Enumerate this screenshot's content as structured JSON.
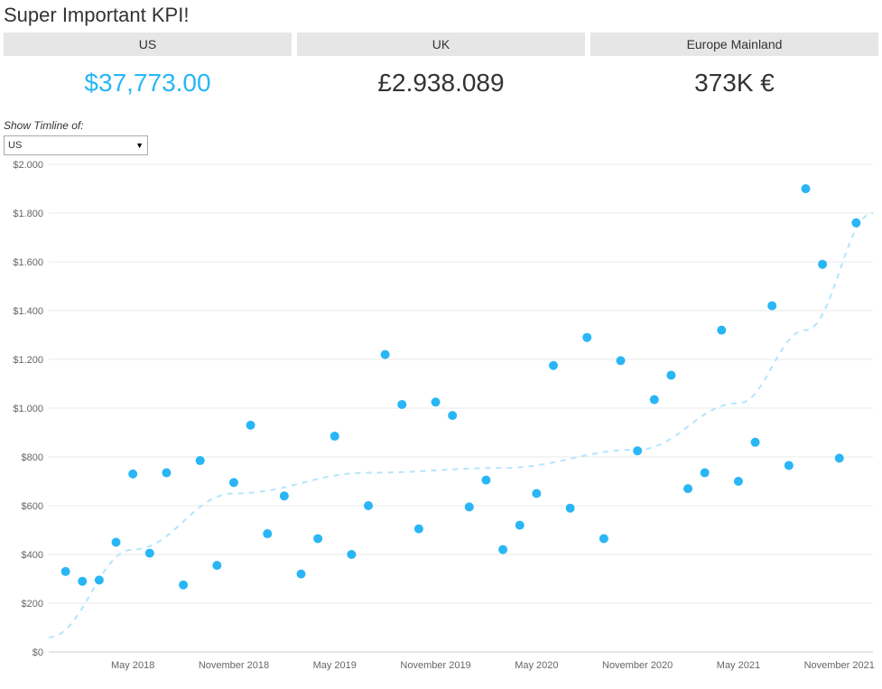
{
  "title": "Super Important KPI!",
  "kpis": [
    {
      "label": "US",
      "value": "$37,773.00",
      "accent": true
    },
    {
      "label": "UK",
      "value": "£2.938.089",
      "accent": false
    },
    {
      "label": "Europe Mainland",
      "value": "373K €",
      "accent": false
    }
  ],
  "filter": {
    "label": "Show Timline of:",
    "selected": "US"
  },
  "chart_data": {
    "type": "scatter",
    "title": "",
    "xlabel": "",
    "ylabel": "",
    "ylim": [
      0,
      2000
    ],
    "y_ticks": [
      "$0",
      "$200",
      "$400",
      "$600",
      "$800",
      "$1.000",
      "$1.200",
      "$1.400",
      "$1.600",
      "$1.800",
      "$2.000"
    ],
    "x_ticks": [
      "May 2018",
      "November 2018",
      "May 2019",
      "November 2019",
      "May 2020",
      "November 2020",
      "May 2021",
      "November 2021"
    ],
    "series": [
      {
        "name": "US",
        "points": [
          {
            "t": 0,
            "y": 330
          },
          {
            "t": 1,
            "y": 290
          },
          {
            "t": 2,
            "y": 295
          },
          {
            "t": 3,
            "y": 450
          },
          {
            "t": 4,
            "y": 730
          },
          {
            "t": 5,
            "y": 405
          },
          {
            "t": 6,
            "y": 735
          },
          {
            "t": 7,
            "y": 275
          },
          {
            "t": 8,
            "y": 785
          },
          {
            "t": 9,
            "y": 355
          },
          {
            "t": 10,
            "y": 695
          },
          {
            "t": 11,
            "y": 930
          },
          {
            "t": 12,
            "y": 485
          },
          {
            "t": 13,
            "y": 640
          },
          {
            "t": 14,
            "y": 320
          },
          {
            "t": 15,
            "y": 465
          },
          {
            "t": 16,
            "y": 885
          },
          {
            "t": 17,
            "y": 400
          },
          {
            "t": 18,
            "y": 600
          },
          {
            "t": 19,
            "y": 1220
          },
          {
            "t": 20,
            "y": 1015
          },
          {
            "t": 21,
            "y": 505
          },
          {
            "t": 22,
            "y": 1025
          },
          {
            "t": 23,
            "y": 970
          },
          {
            "t": 24,
            "y": 595
          },
          {
            "t": 25,
            "y": 705
          },
          {
            "t": 26,
            "y": 420
          },
          {
            "t": 27,
            "y": 520
          },
          {
            "t": 28,
            "y": 650
          },
          {
            "t": 29,
            "y": 1175
          },
          {
            "t": 30,
            "y": 590
          },
          {
            "t": 31,
            "y": 1290
          },
          {
            "t": 32,
            "y": 465
          },
          {
            "t": 33,
            "y": 1195
          },
          {
            "t": 34,
            "y": 825
          },
          {
            "t": 35,
            "y": 1035
          },
          {
            "t": 36,
            "y": 1135
          },
          {
            "t": 37,
            "y": 670
          },
          {
            "t": 38,
            "y": 735
          },
          {
            "t": 39,
            "y": 1320
          },
          {
            "t": 40,
            "y": 700
          },
          {
            "t": 41,
            "y": 860
          },
          {
            "t": 42,
            "y": 1420
          },
          {
            "t": 43,
            "y": 765
          },
          {
            "t": 44,
            "y": 1900
          },
          {
            "t": 45,
            "y": 1590
          },
          {
            "t": 46,
            "y": 795
          },
          {
            "t": 47,
            "y": 1760
          }
        ]
      }
    ],
    "trend": [
      {
        "t": -1,
        "y": 60
      },
      {
        "t": 4,
        "y": 420
      },
      {
        "t": 10,
        "y": 650
      },
      {
        "t": 18,
        "y": 735
      },
      {
        "t": 26,
        "y": 755
      },
      {
        "t": 34,
        "y": 830
      },
      {
        "t": 40,
        "y": 1020
      },
      {
        "t": 44,
        "y": 1320
      },
      {
        "t": 48,
        "y": 1800
      }
    ],
    "t_domain": [
      -1,
      48
    ]
  }
}
